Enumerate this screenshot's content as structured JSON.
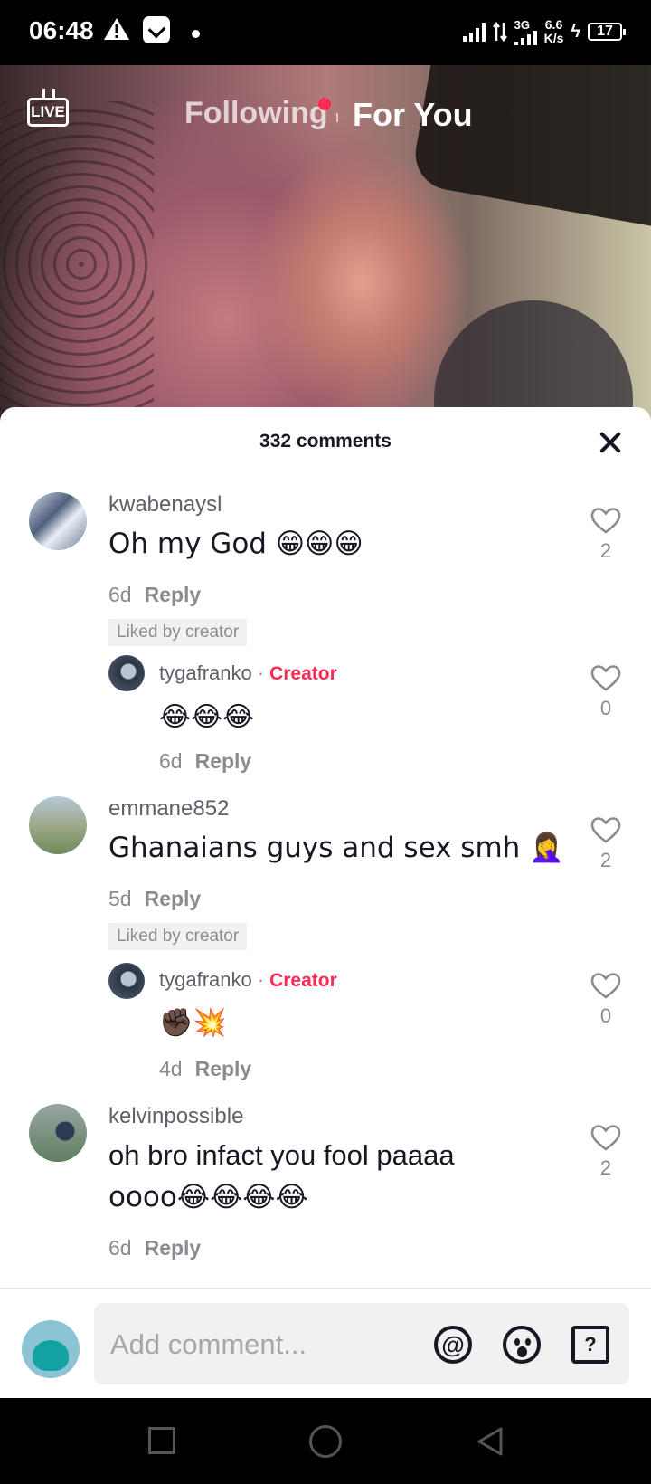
{
  "status_bar": {
    "time": "06:48",
    "net_type": "3G",
    "speed_value": "6.6",
    "speed_unit": "K/s",
    "battery": "17"
  },
  "top_nav": {
    "live_label": "LIVE",
    "following_label": "Following",
    "for_you_label": "For You"
  },
  "comments_panel": {
    "title": "332 comments",
    "comments": [
      {
        "username": "kwabenaysl",
        "text": "Oh my God 😁😁😁",
        "age": "6d",
        "reply_label": "Reply",
        "liked_label": "Liked by creator",
        "likes": "2",
        "reply": {
          "username": "tygafranko",
          "separator": "·",
          "badge": "Creator",
          "text": "😂😂😂",
          "age": "6d",
          "reply_label": "Reply",
          "likes": "0"
        }
      },
      {
        "username": "emmane852",
        "text": "Ghanaians guys and sex smh 🤦‍♀️",
        "age": "5d",
        "reply_label": "Reply",
        "liked_label": "Liked by creator",
        "likes": "2",
        "reply": {
          "username": "tygafranko",
          "separator": "·",
          "badge": "Creator",
          "text": "✊🏿💥",
          "age": "4d",
          "reply_label": "Reply",
          "likes": "0"
        }
      },
      {
        "username": "kelvinpossible",
        "text_line1": "oh bro infact you fool paaaa",
        "text_line2": "oooo😂😂😂😂",
        "age": "6d",
        "reply_label": "Reply",
        "likes": "2"
      }
    ]
  },
  "composer": {
    "placeholder": "Add comment...",
    "at_symbol": "@",
    "question_symbol": "?"
  },
  "colors": {
    "accent": "#fe2c55",
    "text_primary": "#161823",
    "text_secondary": "#8a8b91"
  }
}
